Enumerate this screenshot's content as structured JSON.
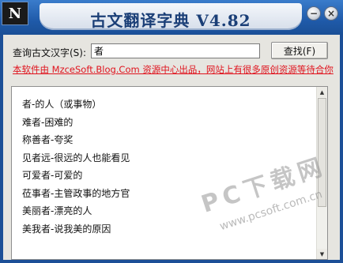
{
  "app": {
    "logo_glyph": "N",
    "title": "古文翻译字典 V4.82"
  },
  "window_controls": {
    "minimize": "−",
    "close": "×"
  },
  "query": {
    "label": "查询古文汉字(S):",
    "value": "者",
    "button": "查找(F)"
  },
  "banner": "本软件由 MzceSoft.Blog.Com 资源中心出品，网站上有很多原创资源等待合你",
  "results": [
    "者-的人（或事物）",
    "难者-困难的",
    "称善者-夸奖",
    "见者远-很远的人也能看见",
    "可爱者-可爱的",
    "莅事者-主管政事的地方官",
    "美丽者-漂亮的人",
    "美我者-说我美的原因"
  ],
  "scrollbar": {
    "up": "▲",
    "down": "▼"
  },
  "watermark": {
    "main": "PC下载网",
    "url": "www.pcsoft.com.cn"
  },
  "colors": {
    "title_bar": "#1f5aa9",
    "banner_text": "#e0141e",
    "content_bg": "#e6e5e0"
  }
}
